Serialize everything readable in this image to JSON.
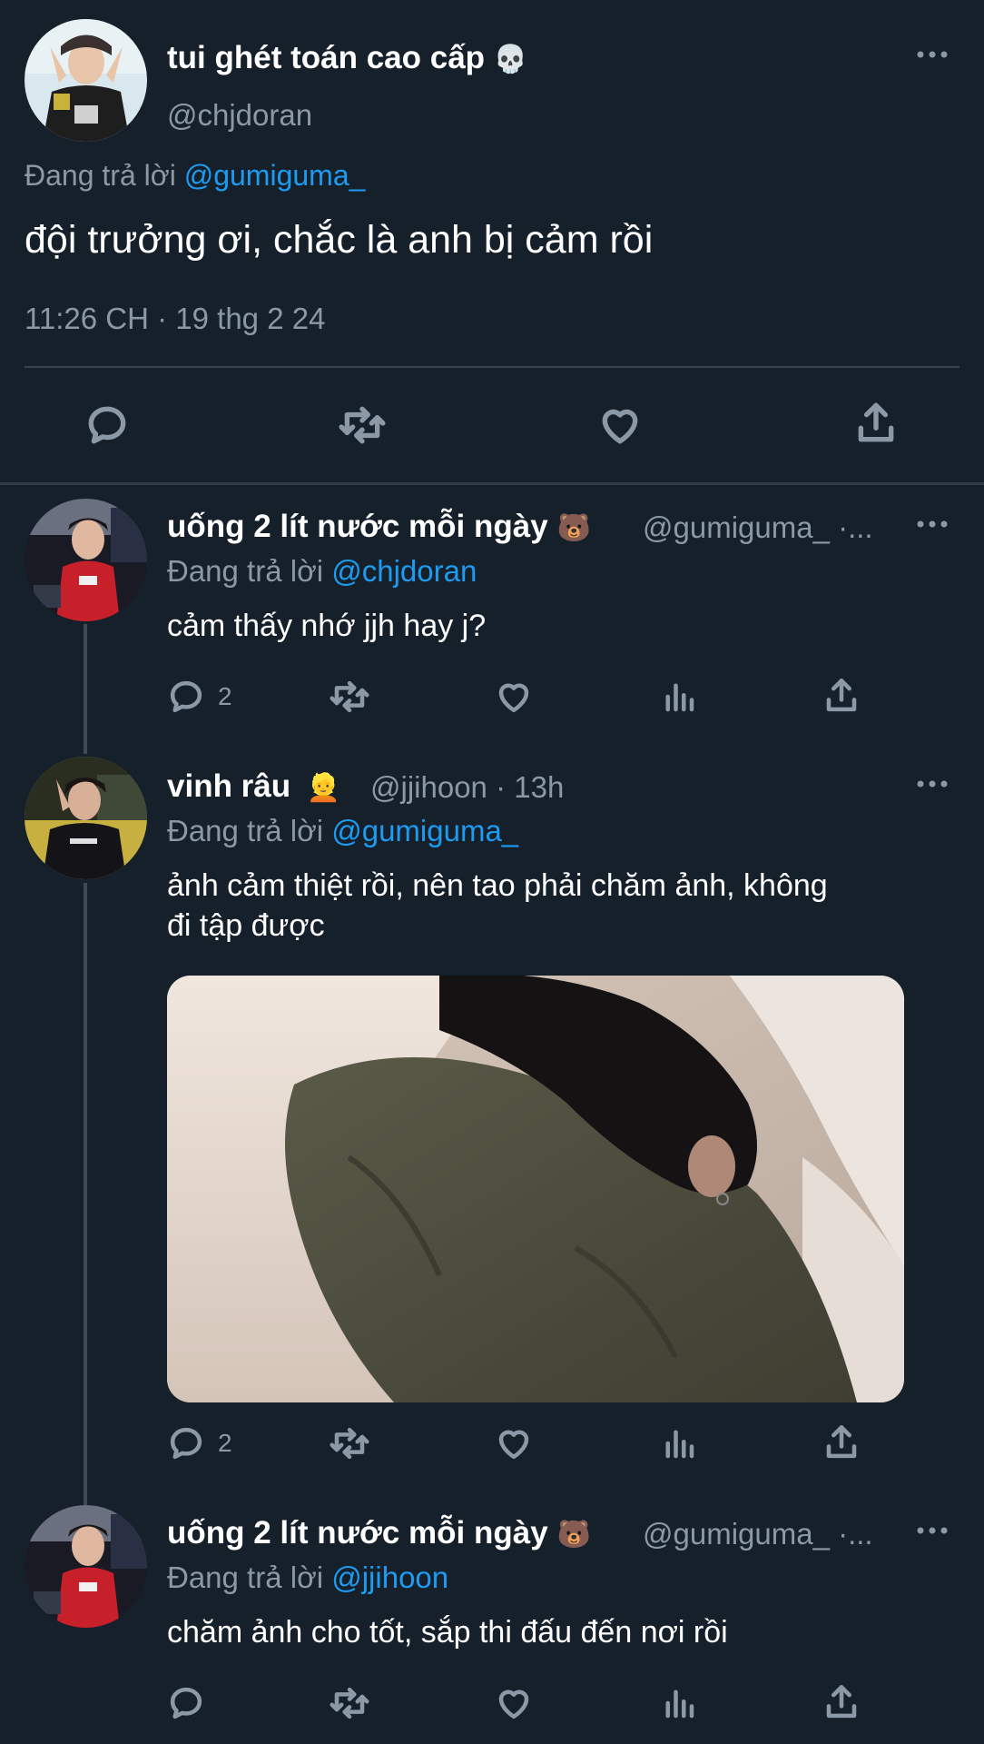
{
  "main_tweet": {
    "display_name": "tui ghét toán cao cấp",
    "name_emoji": "💀",
    "handle": "@chjdoran",
    "replying_prefix": "Đang trả lời ",
    "replying_to": "@gumiguma_",
    "text": "đội trưởng ơi, chắc là anh bị cảm rồi",
    "timestamp": "11:26 CH · 19 thg 2 24"
  },
  "replies": [
    {
      "display_name": "uống 2 lít nước mỗi ngày",
      "name_emoji": "🐻",
      "handle_meta": "@gumiguma_ ·...",
      "replying_prefix": "Đang trả lời ",
      "replying_to": "@chjdoran",
      "text": "cảm thấy nhớ jjh hay j?",
      "reply_count": "2"
    },
    {
      "display_name": "vinh râu",
      "name_emoji": "👱",
      "handle_meta": "@jjihoon · 13h",
      "replying_prefix": "Đang trả lời ",
      "replying_to": "@gumiguma_",
      "text_line1": "ảnh cảm thiệt rồi, nên tao phải chăm ảnh, không",
      "text_line2": "đi tập được",
      "reply_count": "2"
    },
    {
      "display_name": "uống 2 lít nước mỗi ngày",
      "name_emoji": "🐻",
      "handle_meta": "@gumiguma_ ·...",
      "replying_prefix": "Đang trả lời ",
      "replying_to": "@jjihoon",
      "text": "chăm ảnh cho tốt, sắp thi đấu đến nơi rồi"
    }
  ],
  "colors": {
    "background": "#15202b",
    "secondary_text": "#8b98a5",
    "link": "#1d9bf0",
    "divider": "#38444d"
  }
}
